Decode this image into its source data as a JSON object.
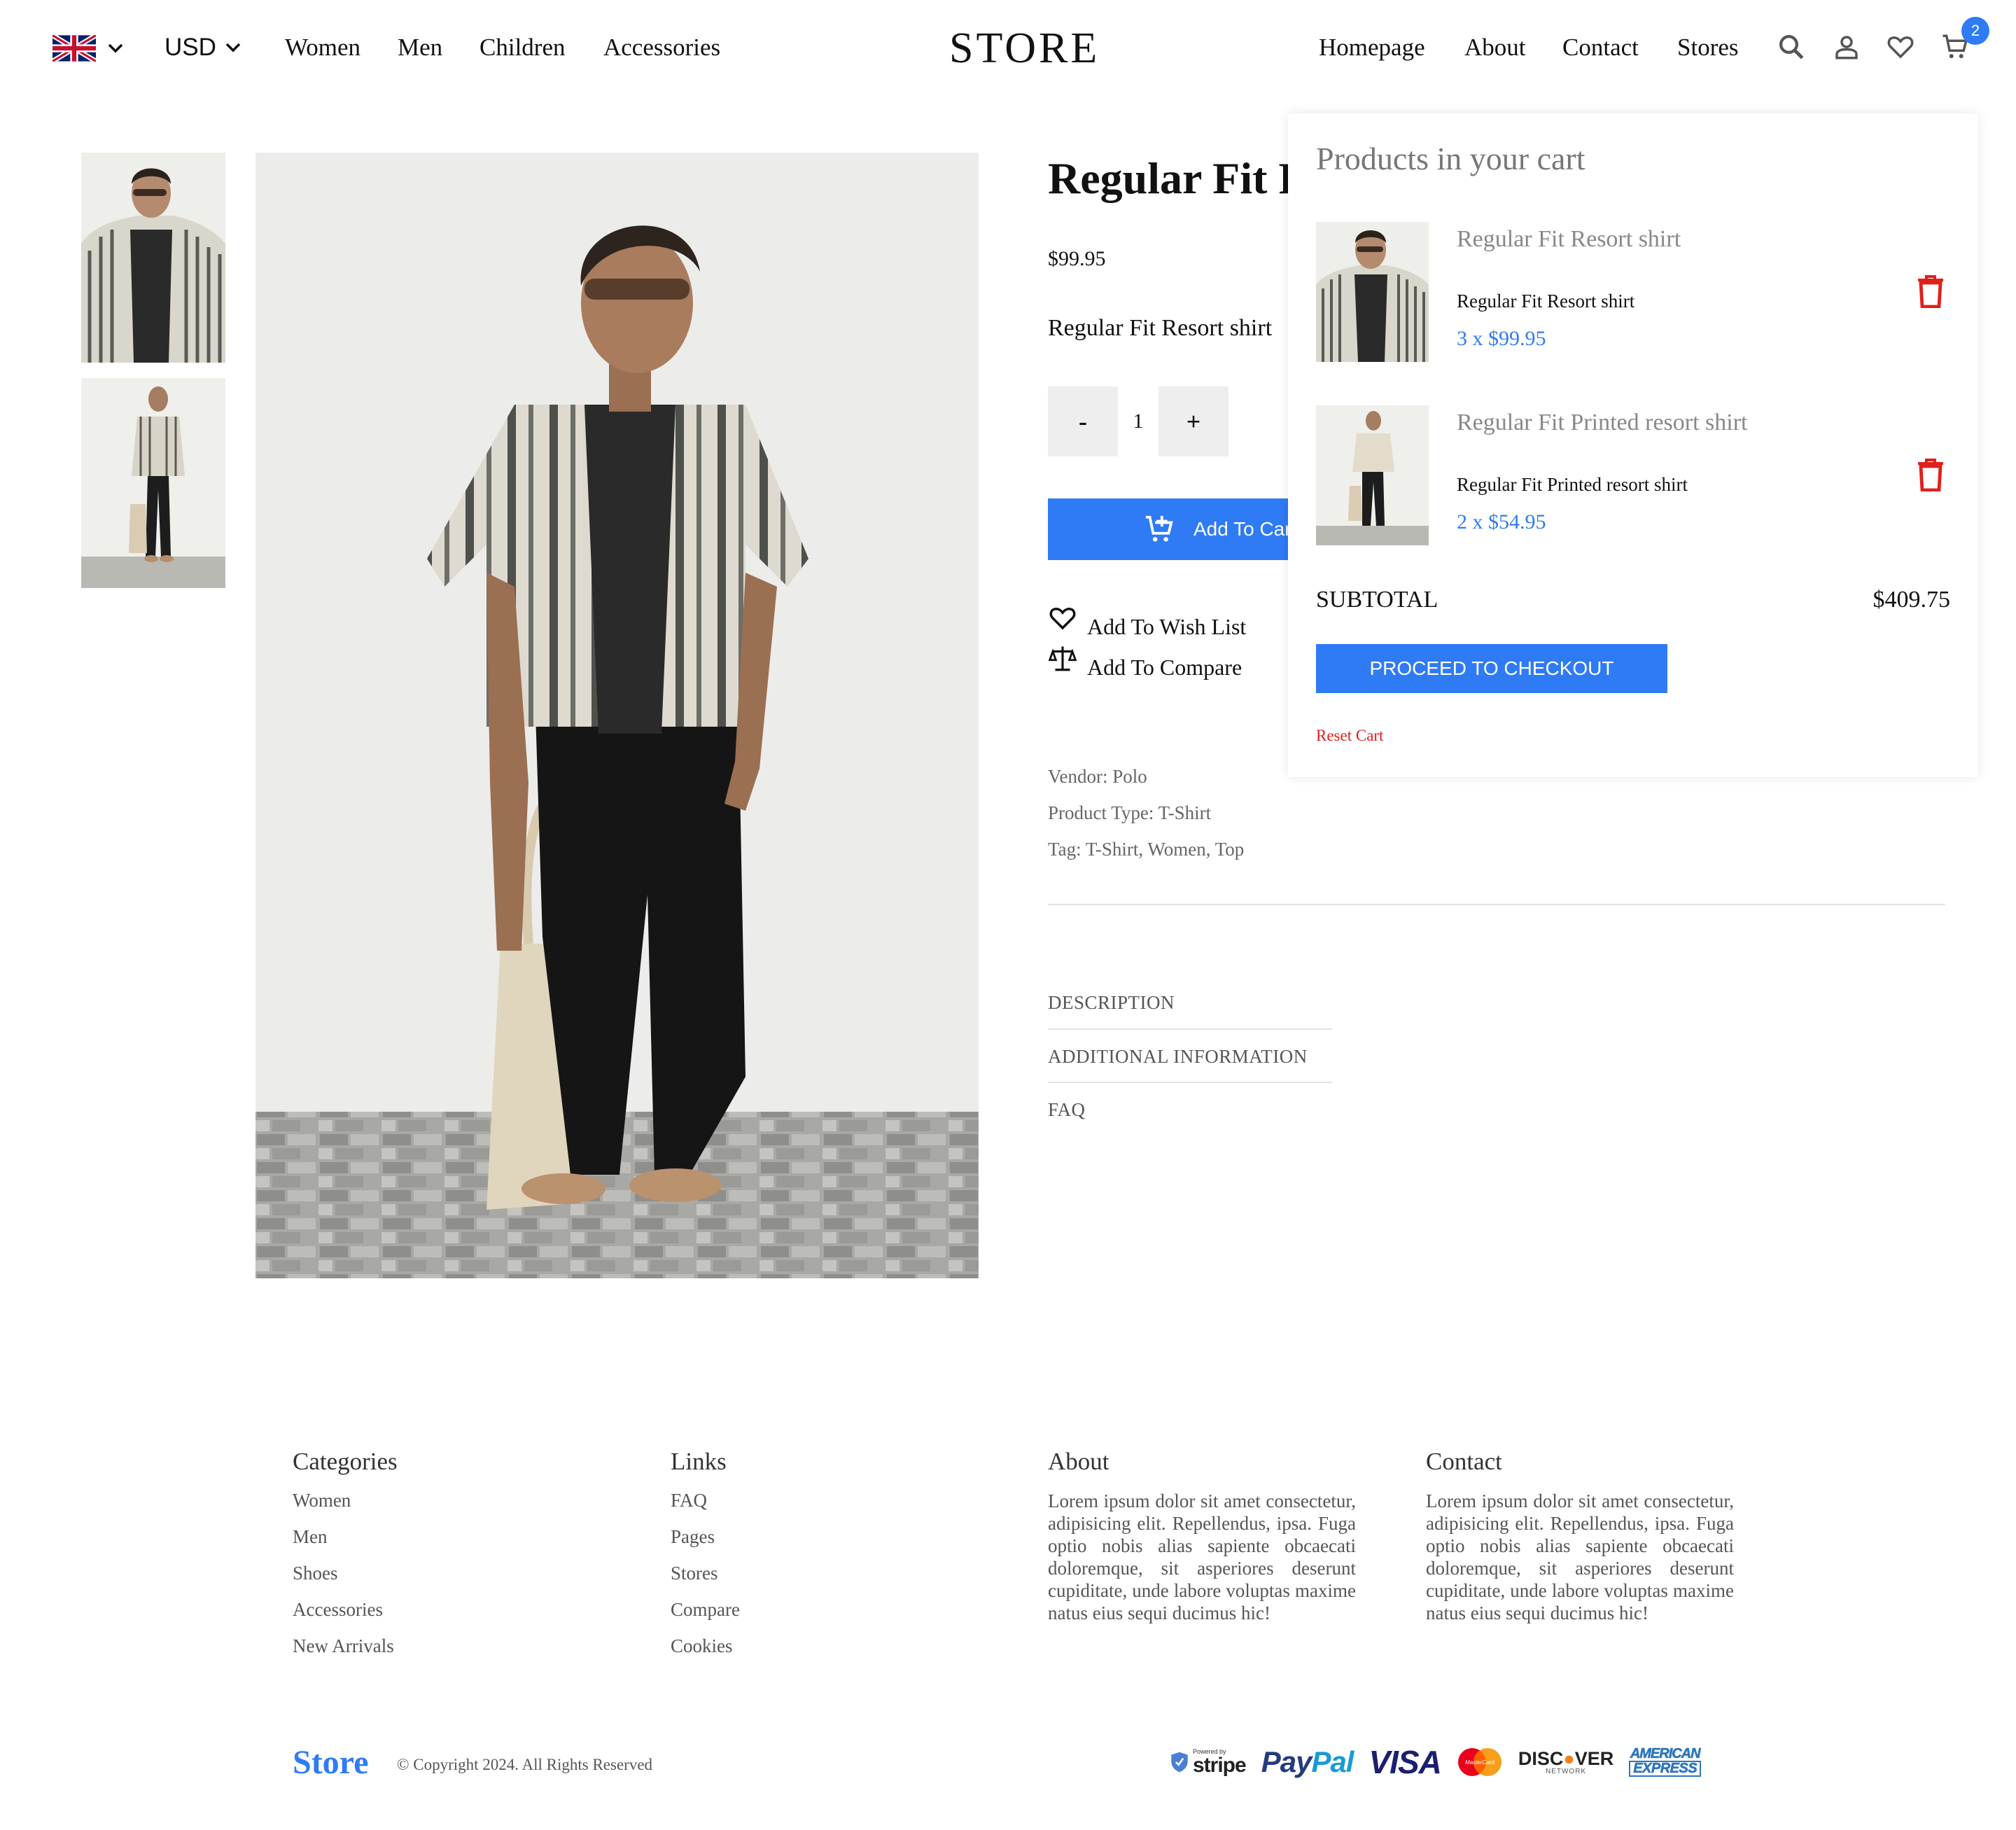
{
  "header": {
    "currency": "USD",
    "nav_left": [
      "Women",
      "Men",
      "Children",
      "Accessories"
    ],
    "logo": "STORE",
    "nav_right": [
      "Homepage",
      "About",
      "Contact",
      "Stores"
    ],
    "cart_count": "2"
  },
  "product": {
    "title": "Regular Fit Resort shirt",
    "price": "$99.95",
    "subtitle": "Regular Fit Resort shirt",
    "qty_minus": "-",
    "qty_value": "1",
    "qty_plus": "+",
    "add_to_cart": "Add To Cart",
    "wish_list": "Add To Wish List",
    "compare": "Add To Compare",
    "vendor": "Vendor: Polo",
    "product_type": "Product Type: T-Shirt",
    "tag": "Tag: T-Shirt, Women, Top",
    "tabs": [
      "DESCRIPTION",
      "ADDITIONAL INFORMATION",
      "FAQ"
    ]
  },
  "cart": {
    "heading": "Products in your cart",
    "items": [
      {
        "name": "Regular Fit Resort shirt",
        "name_small": "Regular Fit Resort shirt",
        "qty_price": "3 x $99.95"
      },
      {
        "name": "Regular Fit Printed resort shirt",
        "name_small": "Regular Fit Printed resort shirt",
        "qty_price": "2 x $54.95"
      }
    ],
    "subtotal_label": "SUBTOTAL",
    "subtotal_value": "$409.75",
    "checkout": "PROCEED TO CHECKOUT",
    "reset": "Reset Cart"
  },
  "footer": {
    "categories": {
      "title": "Categories",
      "links": [
        "Women",
        "Men",
        "Shoes",
        "Accessories",
        "New Arrivals"
      ]
    },
    "links": {
      "title": "Links",
      "links": [
        "FAQ",
        "Pages",
        "Stores",
        "Compare",
        "Cookies"
      ]
    },
    "about": {
      "title": "About",
      "text": "Lorem ipsum dolor sit amet consectetur, adipisicing elit. Repellendus, ipsa. Fuga optio nobis alias sapiente obcaecati doloremque, sit asperiores deserunt cupiditate, unde labore voluptas maxime natus eius sequi ducimus hic!"
    },
    "contact": {
      "title": "Contact",
      "text": "Lorem ipsum dolor sit amet consectetur, adipisicing elit. Repellendus, ipsa. Fuga optio nobis alias sapiente obcaecati doloremque, sit asperiores deserunt cupiditate, unde labore voluptas maxime natus eius sequi ducimus hic!"
    },
    "logo": "Store",
    "copyright": "© Copyright 2024. All Rights Reserved",
    "payment_logos": [
      "Powered by stripe",
      "PayPal",
      "VISA",
      "MasterCard",
      "DISCOVER NETWORK",
      "AMERICAN EXPRESS"
    ]
  },
  "colors": {
    "accent": "#2f7bf5",
    "danger": "#e0201b",
    "muted": "#777777"
  }
}
